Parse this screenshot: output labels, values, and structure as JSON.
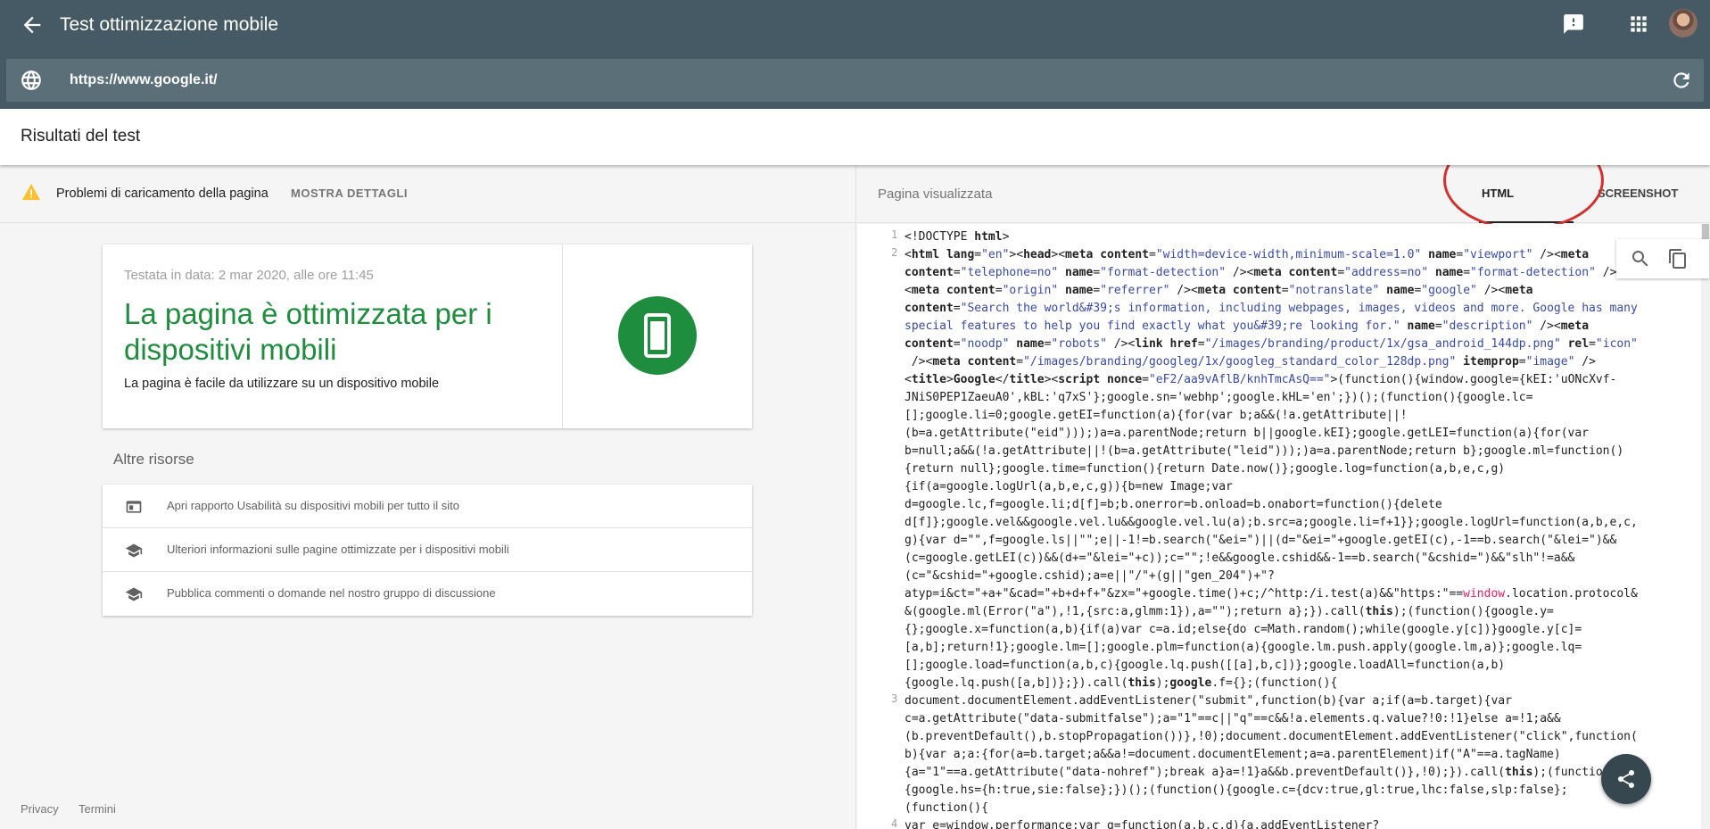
{
  "app": {
    "title": "Test ottimizzazione mobile",
    "url": "https://www.google.it/"
  },
  "results": {
    "title": "Risultati del test"
  },
  "warning": {
    "text": "Problemi di caricamento della pagina",
    "details_label": "MOSTRA DETTAGLI"
  },
  "verdict": {
    "date": "Testata in data: 2 mar 2020, alle ore 11:45",
    "title": "La pagina è ottimizzata per i dispositivi mobili",
    "description": "La pagina è facile da utilizzare su un dispositivo mobile"
  },
  "resources": {
    "title": "Altre risorse",
    "items": [
      {
        "label": "Apri rapporto Usabilità su dispositivi mobili per tutto il sito",
        "icon": "browser-window-icon"
      },
      {
        "label": "Ulteriori informazioni sulle pagine ottimizzate per i dispositivi mobili",
        "icon": "school-icon"
      },
      {
        "label": "Pubblica commenti o domande nel nostro gruppo di discussione",
        "icon": "school-icon"
      }
    ]
  },
  "footer": {
    "privacy": "Privacy",
    "terms": "Termini"
  },
  "rendered": {
    "title": "Pagina visualizzata",
    "tabs": [
      "HTML",
      "SCREENSHOT"
    ],
    "active_tab": "HTML"
  },
  "code": {
    "line_numbers": [
      "1",
      "2",
      "3",
      "4"
    ]
  },
  "colors": {
    "app_bar": "#455a64",
    "success": "#1e8e3e",
    "annotation": "#d32f2f"
  }
}
